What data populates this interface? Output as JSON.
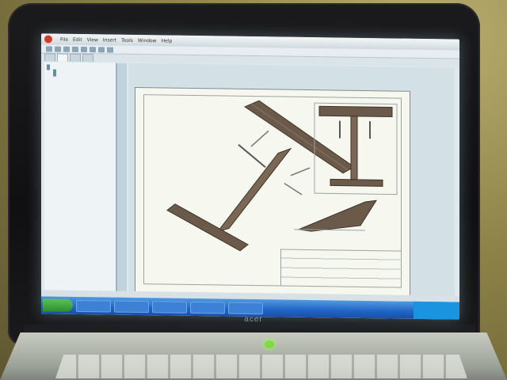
{
  "laptop": {
    "brand": "acer"
  },
  "app": {
    "menu": [
      "File",
      "Edit",
      "View",
      "Insert",
      "Tools",
      "Window",
      "Help"
    ],
    "tabs": [
      "",
      "",
      "",
      ""
    ],
    "tree": [
      "",
      "",
      "",
      "",
      "",
      "",
      ""
    ]
  },
  "colors": {
    "accent": "#1f63c4",
    "led": "#7ddc3a",
    "model": "#6b5a4a"
  },
  "icons": [
    "airplane-drawing-icon",
    "start-icon"
  ]
}
